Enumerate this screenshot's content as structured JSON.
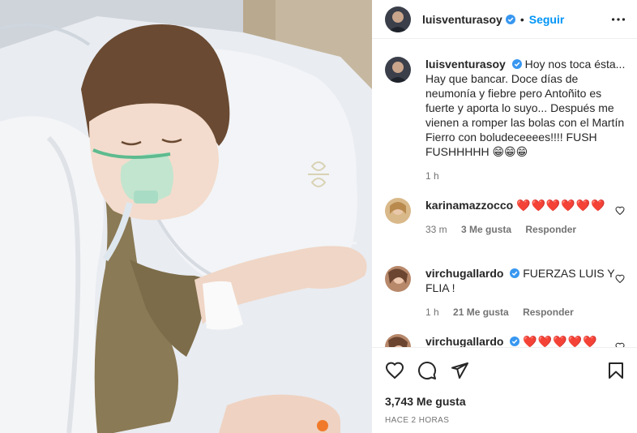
{
  "post": {
    "username": "luisventurasoy",
    "follow_label": "Seguir",
    "separator": "•"
  },
  "caption": {
    "username": "luisventurasoy",
    "text": "Hoy nos toca ésta... Hay que bancar. Doce días de neumonía y fiebre pero Antoñito es fuerte y aporta lo suyo... Después me vienen a romper las bolas con el Martín Fierro con boludeceeees!!!! FUSH FUSHHHHH 😁😁😁",
    "time": "1 h"
  },
  "comments": [
    {
      "username": "karinamazzocco",
      "text": "❤️❤️❤️❤️❤️❤️",
      "time": "33 m",
      "likes": "3 Me gusta",
      "reply_label": "Responder"
    },
    {
      "username": "virchugallardo",
      "text": "FUERZAS LUIS Y FLIA !",
      "time": "1 h",
      "likes": "21 Me gusta",
      "reply_label": "Responder"
    },
    {
      "username": "virchugallardo",
      "text": "❤️❤️❤️❤️❤️"
    }
  ],
  "footer": {
    "likes": "3,743 Me gusta",
    "timestamp": "HACE 2 HORAS"
  },
  "colors": {
    "link_blue": "#0095f6",
    "verified_blue": "#3897f0",
    "heart_red": "#e0102c",
    "secondary_text": "#737373"
  },
  "icons": [
    "verified-badge-icon",
    "more-options-icon",
    "heart-icon",
    "comment-icon",
    "share-icon",
    "bookmark-icon",
    "small-heart-icon"
  ]
}
